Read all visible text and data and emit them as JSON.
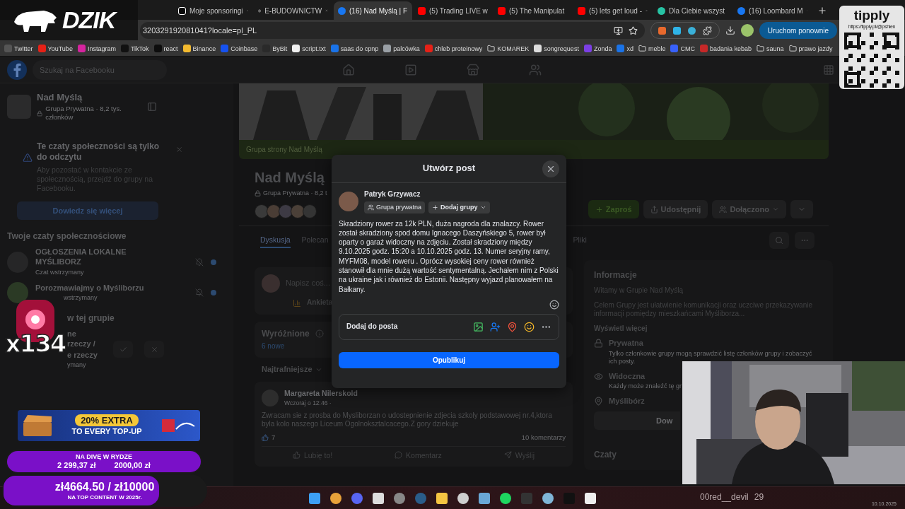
{
  "browser": {
    "tabs": [
      {
        "label": "Moje sponsoringi",
        "kind": "square",
        "selected": false
      },
      {
        "label": "E-BUDOWNICTW",
        "kind": "globe",
        "selected": false
      },
      {
        "label": "(16) Nad Myślą | F",
        "kind": "facebook",
        "selected": true
      },
      {
        "label": "(5) Trading LIVE w",
        "kind": "youtube",
        "selected": false
      },
      {
        "label": "(5) The Manipulat",
        "kind": "youtube",
        "selected": false
      },
      {
        "label": "(5) lets get loud -",
        "kind": "youtube",
        "selected": false
      },
      {
        "label": "Dla Ciebie wszyst",
        "kind": "audio",
        "selected": false
      },
      {
        "label": "(16) Loombard M",
        "kind": "facebook",
        "selected": false
      }
    ],
    "address": "320329192081041?locale=pl_PL",
    "restart_button": "Uruchom ponownie",
    "bookmarks": [
      {
        "label": "Twitter",
        "kind": "site",
        "color": "#555555"
      },
      {
        "label": "YouTube",
        "kind": "site",
        "color": "#e62117"
      },
      {
        "label": "Instagram",
        "kind": "site",
        "color": "#d6249f"
      },
      {
        "label": "TikTok",
        "kind": "site",
        "color": "#111111"
      },
      {
        "label": "react",
        "kind": "site",
        "color": "#0d0d0d"
      },
      {
        "label": "Binance",
        "kind": "site",
        "color": "#f3ba2f"
      },
      {
        "label": "Coinbase",
        "kind": "site",
        "color": "#1652f0"
      },
      {
        "label": "ByBit",
        "kind": "site",
        "color": "#2a2a2a"
      },
      {
        "label": "script.txt",
        "kind": "site",
        "color": "#f0f0f0"
      },
      {
        "label": "saas do cpnp",
        "kind": "site",
        "color": "#1a73e8"
      },
      {
        "label": "palcówka",
        "kind": "site",
        "color": "#9aa0a6"
      },
      {
        "label": "chleb proteinowy",
        "kind": "site",
        "color": "#e62117"
      },
      {
        "label": "KOMAREK",
        "kind": "folder"
      },
      {
        "label": "songrequest",
        "kind": "site",
        "color": "#dddddd"
      },
      {
        "label": "Zonda",
        "kind": "site",
        "color": "#7b3fe4"
      },
      {
        "label": "xd",
        "kind": "site",
        "color": "#1a73e8"
      },
      {
        "label": "meble",
        "kind": "folder"
      },
      {
        "label": "CMC",
        "kind": "site",
        "color": "#3861fb"
      },
      {
        "label": "badania kebab",
        "kind": "site",
        "color": "#c62828"
      },
      {
        "label": "sauna",
        "kind": "folder"
      },
      {
        "label": "prawo jazdy",
        "kind": "folder"
      }
    ]
  },
  "facebook": {
    "search": {
      "placeholder": "Szukaj na Facebooku"
    },
    "sidebar": {
      "group": {
        "name": "Nad Myślą",
        "meta": "Grupa Prywatna · 8,2 tys. członków"
      },
      "notice": {
        "title": "Te czaty społeczności są tylko do odczytu",
        "text": "Aby pozostać w kontakcie ze społecznością, przejdź do grupy na Facebooku.",
        "button": "Dowiedz się więcej"
      },
      "chats_heading": "Twoje czaty społecznościowe",
      "chats": [
        {
          "name": "OGŁOSZENIA LOKALNE MYŚLIBORZ",
          "status": "Czat wstrzymany"
        },
        {
          "name": "Porozmawiajmy o Myśliborzu",
          "status": "wstrzymany"
        }
      ],
      "group_chats_heading": "w tej grupie",
      "group_chat": {
        "lines": [
          "ne rzeczy /",
          "e rzeczy"
        ],
        "status": "ymany"
      }
    },
    "group_header": {
      "cover_caption": "Grupa strony Nad Myślą",
      "title": "Nad Myślą",
      "meta": "Grupa Prywatna · 8,2 t",
      "actions": [
        {
          "label": "Zaproś",
          "kind": "invite"
        },
        {
          "label": "Udostępnij",
          "kind": "share"
        },
        {
          "label": "Dołączono",
          "kind": "joined"
        }
      ]
    },
    "tabs": [
      {
        "label": "Dyskusja",
        "selected": true
      },
      {
        "label": "Polecan",
        "selected": false
      },
      {
        "label": "Pliki",
        "selected": false
      }
    ],
    "composer": {
      "placeholder": "Napisz coś...",
      "action": "Ankieta"
    },
    "featured": {
      "title": "Wyróżnione",
      "link": "6 nowe"
    },
    "sort": "Najtrafniejsze",
    "post": {
      "author": "Margareta Nilerskold",
      "time": "Wczoraj o 12:46 ·",
      "text": "Zwracam sie z prosba do Mysliborzan o udostepnienie zdjecia szkoly podstawowej nr.4,ktora byla kolo naszego Liceum Ogolnoksztalcacego.Z gory dziekuje",
      "reactions": "7",
      "comments": "10 komentarzy",
      "actions": [
        "Lubię to!",
        "Komentarz",
        "Wyślij"
      ]
    },
    "about": {
      "heading": "Informacje",
      "welcome": "Witamy w Grupie Nad Myślą",
      "description": "Celem Grupy jest ułatwienie komunikacji oraz uczciwe przekazywanie informacji pomiędzy mieszkańcami Myśliborza...",
      "more": "Wyświetl więcej",
      "facts": [
        {
          "kind": "lock",
          "title": "Prywatna",
          "text": "Tylko członkowie grupy mogą sprawdzić listę członków grupy i zobaczyć ich posty."
        },
        {
          "kind": "eye",
          "title": "Widoczna",
          "text": "Każdy może znaleźć tę gr"
        },
        {
          "kind": "pin",
          "title": "Myślibórz"
        }
      ],
      "button": "Dow",
      "chats_heading": "Czaty"
    }
  },
  "modal": {
    "title": "Utwórz post",
    "author": "Patryk Grzywacz",
    "audience": "Grupa prywatna",
    "add_groups": "Dodaj grupy",
    "text": "Skradziony rower za 12k PLN, duża nagroda dla znalazcy. Rower został skradziony spod domu Ignacego Daszyńskiego 5, rower był oparty o garaż widoczny na zdjęciu. Został skradziony między 9.10.2025 godz. 15:20 a 10.10.2025 godz. 13. Numer seryjny ramy, MYFM08, model roweru . Oprócz wysokiej ceny rower również stanowił dla mnie dużą wartość sentymentalną. Jechałem nim z Polski na ukraine jak i również do Estonii. Następny wyjazd planowałem na Bałkany.",
    "add_to_post": "Dodaj do posta",
    "submit": "Opublikuj"
  },
  "overlay": {
    "logo": "DZIK",
    "tipply": {
      "brand": "tipply",
      "url": "https://tipply.pl/@pshien"
    },
    "alert_count": "x134",
    "promo": {
      "headline": "20% EXTRA",
      "subline": "TO EVERY TOP-UP"
    },
    "goals": [
      {
        "kind": "split",
        "title": "NA DIVĘ W RYDZE",
        "raised": "2 299,37 zł",
        "target": "2000,00 zł",
        "level": 1
      },
      {
        "kind": "total",
        "amount": "zł4664.50 / zł10000",
        "title": "NA TOP CONTENT W 2025r.",
        "level": 0.77
      }
    ],
    "chat": {
      "user": "00red__devil",
      "count": "29"
    }
  },
  "taskbar": {
    "date": "10.10.2025"
  }
}
